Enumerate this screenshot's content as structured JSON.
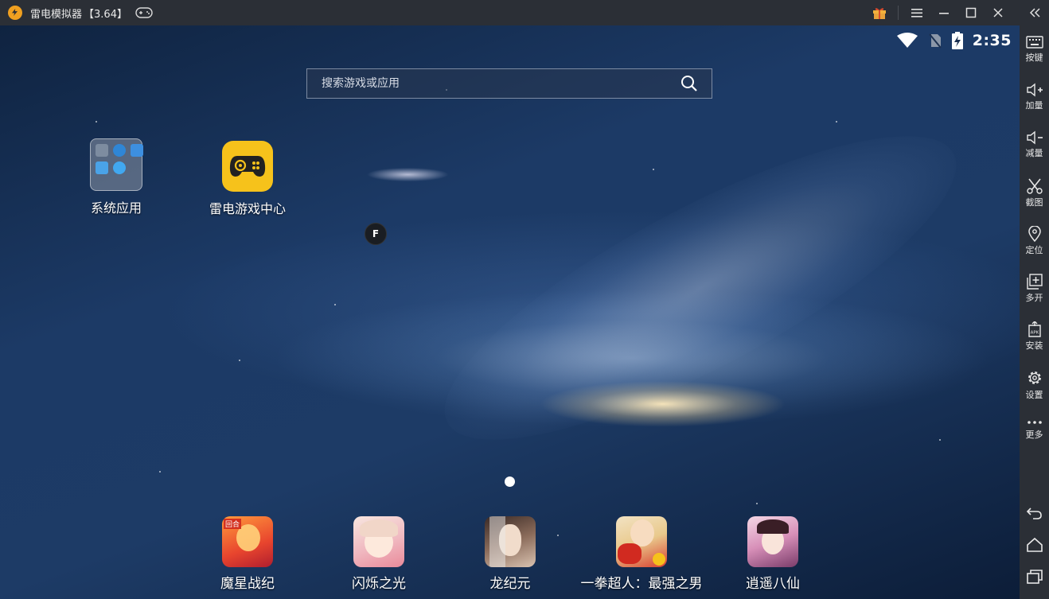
{
  "window": {
    "title": "雷电模拟器",
    "version": "【3.64】",
    "icons": [
      "leidian-logo-icon",
      "gamepad-icon",
      "gift-icon",
      "menu-icon",
      "minimize-icon",
      "maximize-icon",
      "close-icon",
      "collapse-sidebar-icon"
    ]
  },
  "statusbar": {
    "time": "2:35",
    "icons": [
      "wifi-icon",
      "no-sim-icon",
      "battery-charging-icon"
    ]
  },
  "search": {
    "placeholder": "搜索游戏或应用"
  },
  "desktop": {
    "folder": {
      "label": "系统应用",
      "mini_icons": [
        "settings-icon",
        "browser-icon",
        "files-icon",
        "contacts-icon",
        "download-icon"
      ]
    },
    "game_center": {
      "label": "雷电游戏中心"
    },
    "floating_button": {
      "label": "F"
    }
  },
  "dock": [
    {
      "label": "魔星战纪",
      "icon": "moxing-zhanji-app-icon",
      "badge": "回合"
    },
    {
      "label": "闪烁之光",
      "icon": "shanshuo-zhiguang-app-icon"
    },
    {
      "label": "龙纪元",
      "icon": "long-jiyuan-app-icon"
    },
    {
      "label": "一拳超人：最强之男",
      "icon": "one-punch-man-app-icon"
    },
    {
      "label": "逍遥八仙",
      "icon": "xiaoyao-baxian-app-icon"
    }
  ],
  "sidebar": {
    "tools": [
      {
        "label": "按键",
        "icon": "keyboard-icon"
      },
      {
        "label": "加量",
        "icon": "volume-up-icon"
      },
      {
        "label": "减量",
        "icon": "volume-down-icon"
      },
      {
        "label": "截图",
        "icon": "scissors-icon"
      },
      {
        "label": "定位",
        "icon": "location-pin-icon"
      },
      {
        "label": "多开",
        "icon": "multi-instance-icon"
      },
      {
        "label": "安装",
        "icon": "apk-install-icon"
      },
      {
        "label": "设置",
        "icon": "gear-icon"
      },
      {
        "label": "更多",
        "icon": "more-dots-icon"
      }
    ],
    "nav": [
      "back-icon",
      "home-icon",
      "recents-icon"
    ]
  },
  "colors": {
    "titlebar": "#2b2f36",
    "gamecenter": "#f6c21b",
    "gift": "#e8a23a"
  }
}
